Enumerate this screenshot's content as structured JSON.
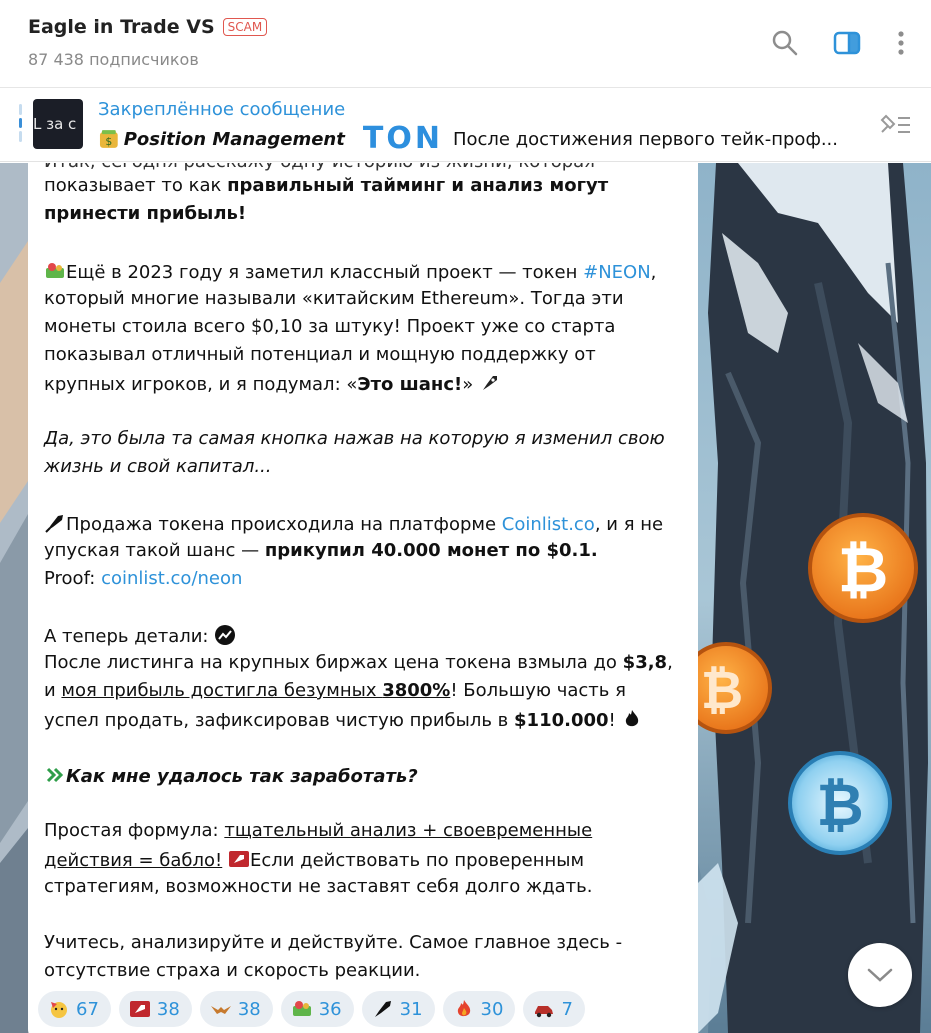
{
  "header": {
    "title": "Eagle in Trade VS",
    "scam_badge": "SCAM",
    "subscribers": "87 438 подписчиков"
  },
  "pinned": {
    "label": "Закреплённое сообщение",
    "thumb_text": "L за с",
    "preview_title": "Position Management",
    "ton_logo": "TON",
    "preview_text": "После достижения первого тейк-проф..."
  },
  "message": {
    "top_cut": "Итак, сегодня расскажу одну историю из жизни, которая",
    "l1_a": "показывает то как ",
    "l1_b": "правильный тайминг и анализ могут",
    "l2": "принести прибыль!",
    "l3_a": "Ещё в 2023 году я заметил классный проект — токен ",
    "l3_link": "#NEON",
    "l3_b": ",",
    "l4": "который многие называли «китайским Ethereum». Тогда эти",
    "l5": "монеты стоила всего $0,10 за штуку! Проект уже со старта",
    "l6": "показывал отличный потенциал и мощную поддержку от",
    "l7_a": "крупных игроков, и я подумал: «",
    "l7_b": "Это шанс!",
    "l7_c": "»",
    "l8": "Да, это была та самая кнопка нажав на которую я изменил свою",
    "l9": "жизнь и свой капитал...",
    "l10_a": "Продажа токена происходила на платформе ",
    "l10_link": "Coinlist.co",
    "l10_b": ", и я не",
    "l11_a": "упуская такой шанс — ",
    "l11_b": "прикупил 40.000 монет по $0.1.",
    "l12_a": "Proof: ",
    "l12_link": "coinlist.co/neon",
    "l13": "А теперь детали:",
    "l14_a": "После листинга на крупных биржах цена токена взмыла до ",
    "l14_b": "$3,8",
    "l14_c": ",",
    "l15_a": "и ",
    "l15_u": "моя прибыль достигла безумных ",
    "l15_ub": "3800%",
    "l15_c": "! Большую часть я",
    "l16_a": "успел продать, зафиксировав чистую прибыль в ",
    "l16_b": "$110.000",
    "l16_c": "!",
    "l17": "Как мне удалось так заработать?",
    "l18_a": "Простая формула: ",
    "l18_u": "тщательный анализ + своевременные",
    "l19_u": "действия = бабло!",
    "l19_b": "Если действовать по проверенным",
    "l20": "стратегиям, возможности не заставят себя долго ждать.",
    "l21": "Учитесь, анализируйте и действуйте. Самое главное здесь -",
    "l22": "отсутствие страха и скорость реакции."
  },
  "reactions": [
    {
      "icon": "party-face-icon",
      "count": "67"
    },
    {
      "icon": "rocket-gift-icon",
      "count": "38"
    },
    {
      "icon": "eagle-icon",
      "count": "38"
    },
    {
      "icon": "money-pile-icon",
      "count": "36"
    },
    {
      "icon": "rocket-icon",
      "count": "31"
    },
    {
      "icon": "fire-icon",
      "count": "30"
    },
    {
      "icon": "car-icon",
      "count": "7"
    }
  ],
  "colors": {
    "accent": "#2e92d9",
    "scam": "#e0574f",
    "bitcoin": "#f28c28"
  }
}
